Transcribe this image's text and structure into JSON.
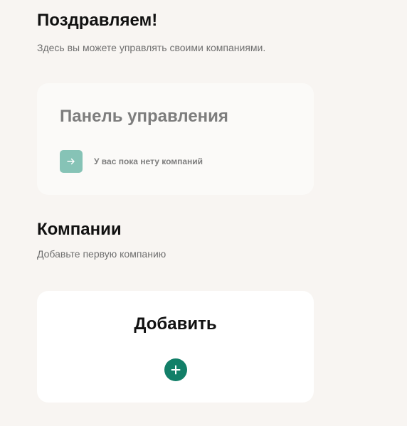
{
  "header": {
    "title": "Поздравляем!",
    "subtitle": "Здесь вы можете управлять своими компаниями."
  },
  "dashboard": {
    "title": "Панель управления",
    "empty_message": "У вас пока нету компаний",
    "arrow_icon": "arrow-right-icon",
    "arrow_bg": "#86c3b6"
  },
  "companies": {
    "heading": "Компании",
    "subtitle": "Добавьте первую компанию"
  },
  "add_card": {
    "label": "Добавить",
    "plus_icon": "plus-icon",
    "accent": "#127f68"
  }
}
